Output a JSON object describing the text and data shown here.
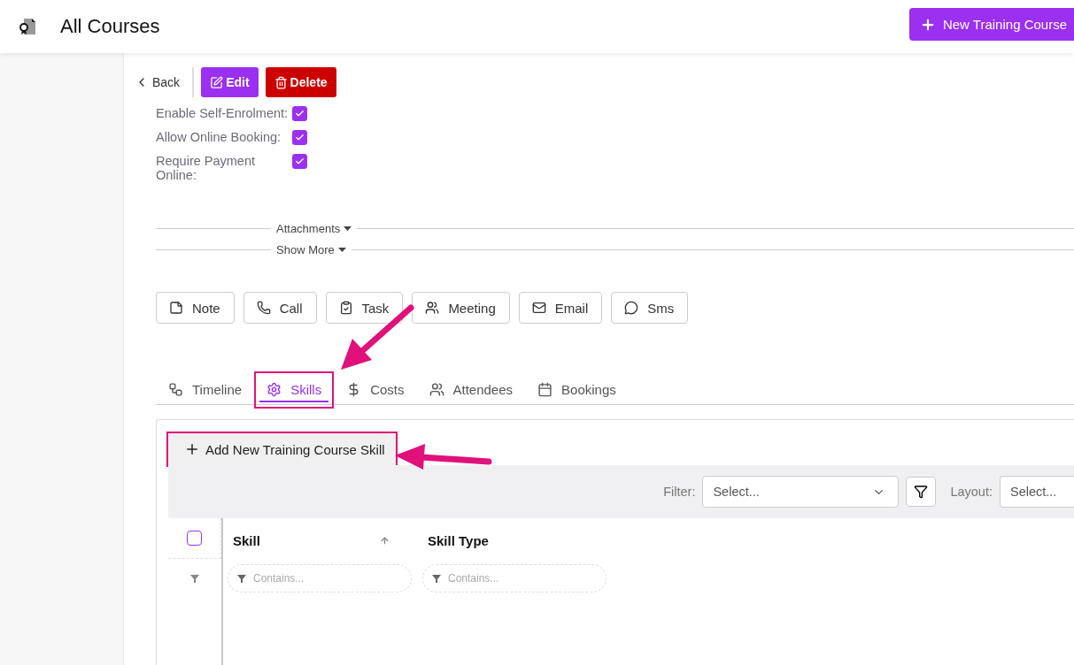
{
  "header": {
    "title": "All Courses",
    "new_button": "New Training Course"
  },
  "toolbar": {
    "back": "Back",
    "edit": "Edit",
    "delete": "Delete"
  },
  "fields": [
    {
      "label": "Enable Self-Enrolment:",
      "checked": true
    },
    {
      "label": "Allow Online Booking:",
      "checked": true
    },
    {
      "label": "Require Payment Online:",
      "checked": true
    }
  ],
  "sections": [
    {
      "label": "Attachments"
    },
    {
      "label": "Show More"
    }
  ],
  "activities": [
    {
      "kind": "note",
      "label": "Note"
    },
    {
      "kind": "call",
      "label": "Call"
    },
    {
      "kind": "task",
      "label": "Task"
    },
    {
      "kind": "meeting",
      "label": "Meeting"
    },
    {
      "kind": "email",
      "label": "Email"
    },
    {
      "kind": "sms",
      "label": "Sms"
    }
  ],
  "tabs": [
    {
      "kind": "timeline",
      "label": "Timeline",
      "selected": false,
      "highlighted": false
    },
    {
      "kind": "skills",
      "label": "Skills",
      "selected": true,
      "highlighted": true
    },
    {
      "kind": "costs",
      "label": "Costs",
      "selected": false,
      "highlighted": false
    },
    {
      "kind": "attendees",
      "label": "Attendees",
      "selected": false,
      "highlighted": false
    },
    {
      "kind": "bookings",
      "label": "Bookings",
      "selected": false,
      "highlighted": false
    }
  ],
  "add_button": {
    "label": "Add New Training Course Skill",
    "highlighted": true
  },
  "grid_toolbar": {
    "filter_label": "Filter:",
    "filter_placeholder": "Select...",
    "layout_label": "Layout:",
    "layout_placeholder": "Select..."
  },
  "grid": {
    "select_all": {
      "checked": false
    },
    "columns": [
      {
        "label": "Skill",
        "sorted": true,
        "filter_placeholder": "Contains..."
      },
      {
        "label": "Skill Type",
        "sorted": false,
        "filter_placeholder": "Contains..."
      }
    ]
  }
}
